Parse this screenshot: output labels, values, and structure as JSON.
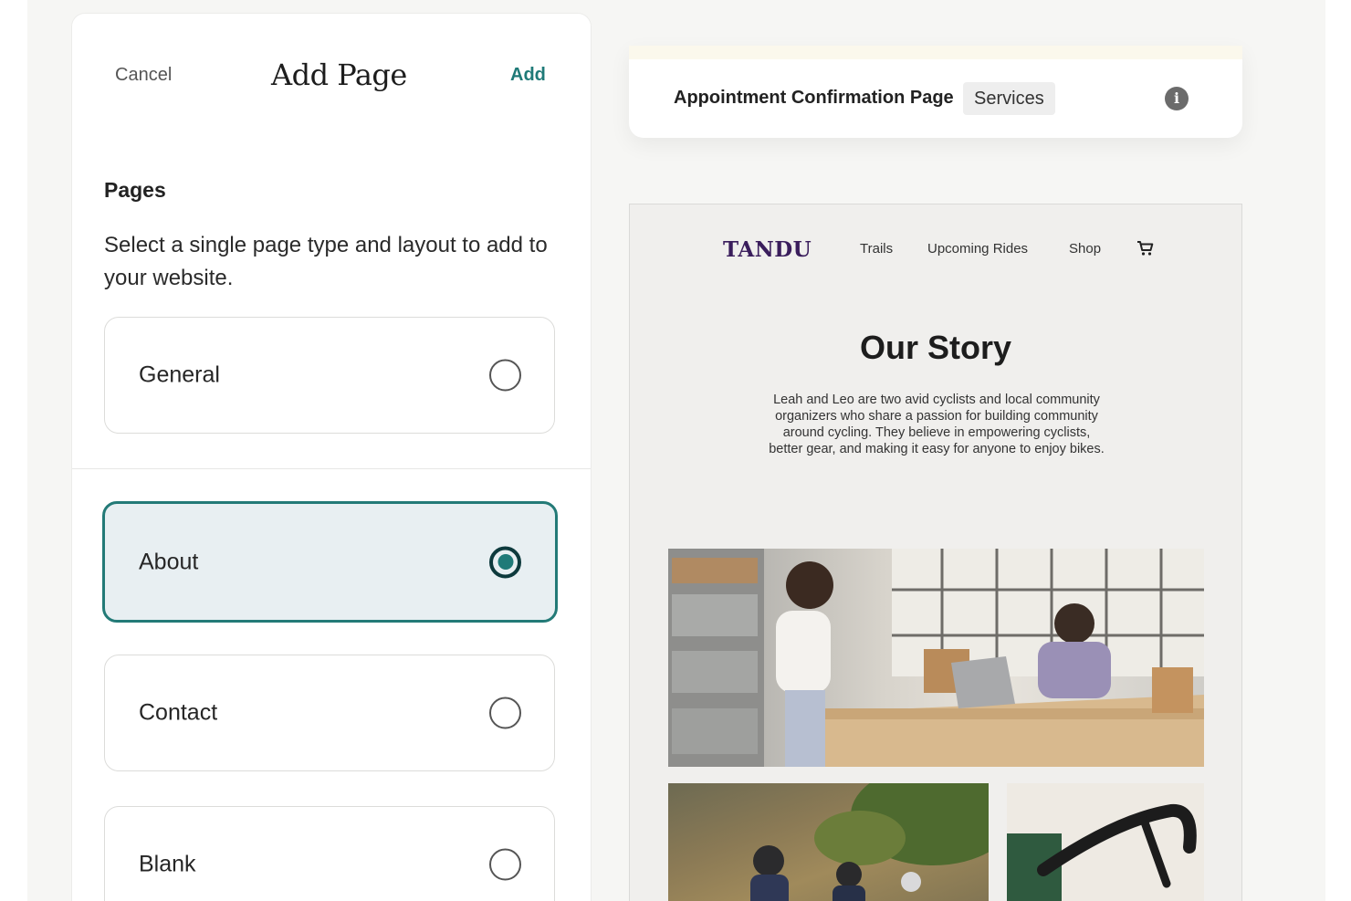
{
  "panel": {
    "cancel_label": "Cancel",
    "title": "Add Page",
    "add_label": "Add",
    "section_title": "Pages",
    "section_description": "Select a single page type and layout to add to your website.",
    "options": [
      {
        "label": "General",
        "selected": false
      },
      {
        "label": "About",
        "selected": true
      },
      {
        "label": "Contact",
        "selected": false
      },
      {
        "label": "Blank",
        "selected": false
      }
    ]
  },
  "preview": {
    "page_name": "Appointment Confirmation Page",
    "page_tag": "Services",
    "site": {
      "logo": "TANDU",
      "nav": [
        "Trails",
        "Upcoming Rides",
        "Shop"
      ],
      "heading": "Our Story",
      "body": "Leah and Leo are two avid cyclists and local community organizers who share a passion for building community around cycling. They believe in empowering cyclists, better gear, and making it easy for anyone to enjoy bikes."
    }
  },
  "colors": {
    "accent": "#1f7a78",
    "selected_bg": "#e8eff2",
    "logo": "#3a1d5c"
  },
  "icons": [
    "info-icon",
    "cart-icon"
  ]
}
